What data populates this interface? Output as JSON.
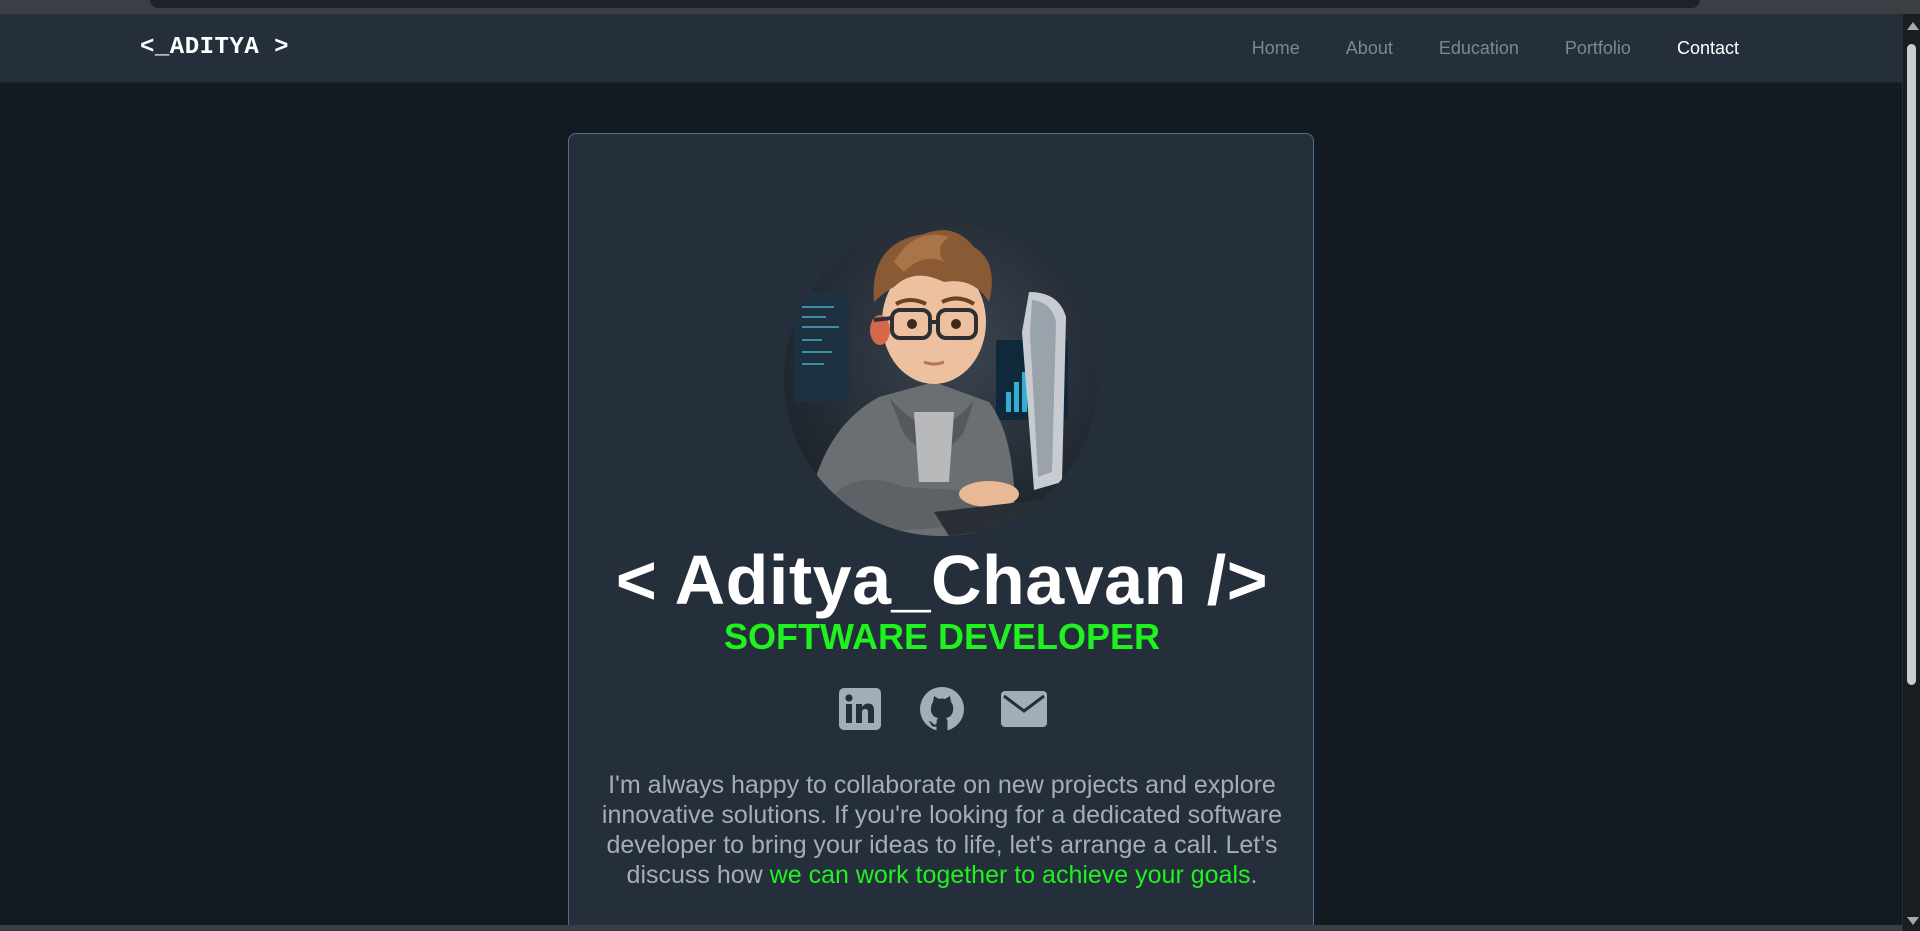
{
  "navbar": {
    "brand": "<_ADITYA >",
    "links": [
      {
        "label": "Home",
        "active": false
      },
      {
        "label": "About",
        "active": false
      },
      {
        "label": "Education",
        "active": false
      },
      {
        "label": "Portfolio",
        "active": false
      },
      {
        "label": "Contact",
        "active": true
      }
    ]
  },
  "profile": {
    "avatar_icon": "developer-avatar",
    "name": "< Aditya_Chavan />",
    "role": "SOFTWARE DEVELOPER",
    "socials": [
      {
        "icon": "linkedin-icon"
      },
      {
        "icon": "github-icon"
      },
      {
        "icon": "email-icon"
      }
    ],
    "description_plain": "I'm always happy to collaborate on new projects and explore innovative solutions. If you're looking for a dedicated software developer to bring your ideas to life, let's arrange a call. Let's discuss how ",
    "description_highlight": "we can work together to achieve your goals",
    "description_end": "."
  },
  "colors": {
    "page_bg": "#141a21",
    "navbar_bg": "#252f3b",
    "card_bg": "#252f3b",
    "card_border": "#4f6e92",
    "accent_green": "#1ff21f",
    "nav_inactive": "#7b8794",
    "nav_active": "#ffffff",
    "text_muted": "#a4adb8"
  }
}
